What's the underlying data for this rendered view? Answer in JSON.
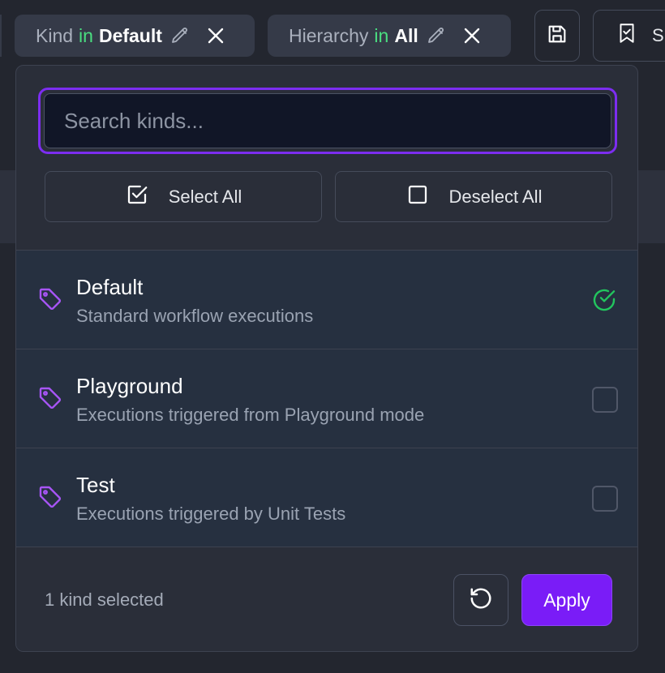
{
  "chips": [
    {
      "field": "Kind",
      "op": "in",
      "value": "Default"
    },
    {
      "field": "Hierarchy",
      "op": "in",
      "value": "All"
    }
  ],
  "toolbar": {
    "partial_label": "S"
  },
  "search": {
    "placeholder": "Search kinds...",
    "value": ""
  },
  "bulk": {
    "select_all": "Select All",
    "deselect_all": "Deselect All"
  },
  "kinds": [
    {
      "title": "Default",
      "description": "Standard workflow executions",
      "selected": true
    },
    {
      "title": "Playground",
      "description": "Executions triggered from Playground mode",
      "selected": false
    },
    {
      "title": "Test",
      "description": "Executions triggered by Unit Tests",
      "selected": false
    }
  ],
  "footer": {
    "count_text": "1 kind selected",
    "apply_label": "Apply"
  },
  "colors": {
    "accent": "#7a1cf7",
    "in_keyword": "#4ade80",
    "tag_icon": "#a855f7",
    "check": "#22c55e"
  }
}
